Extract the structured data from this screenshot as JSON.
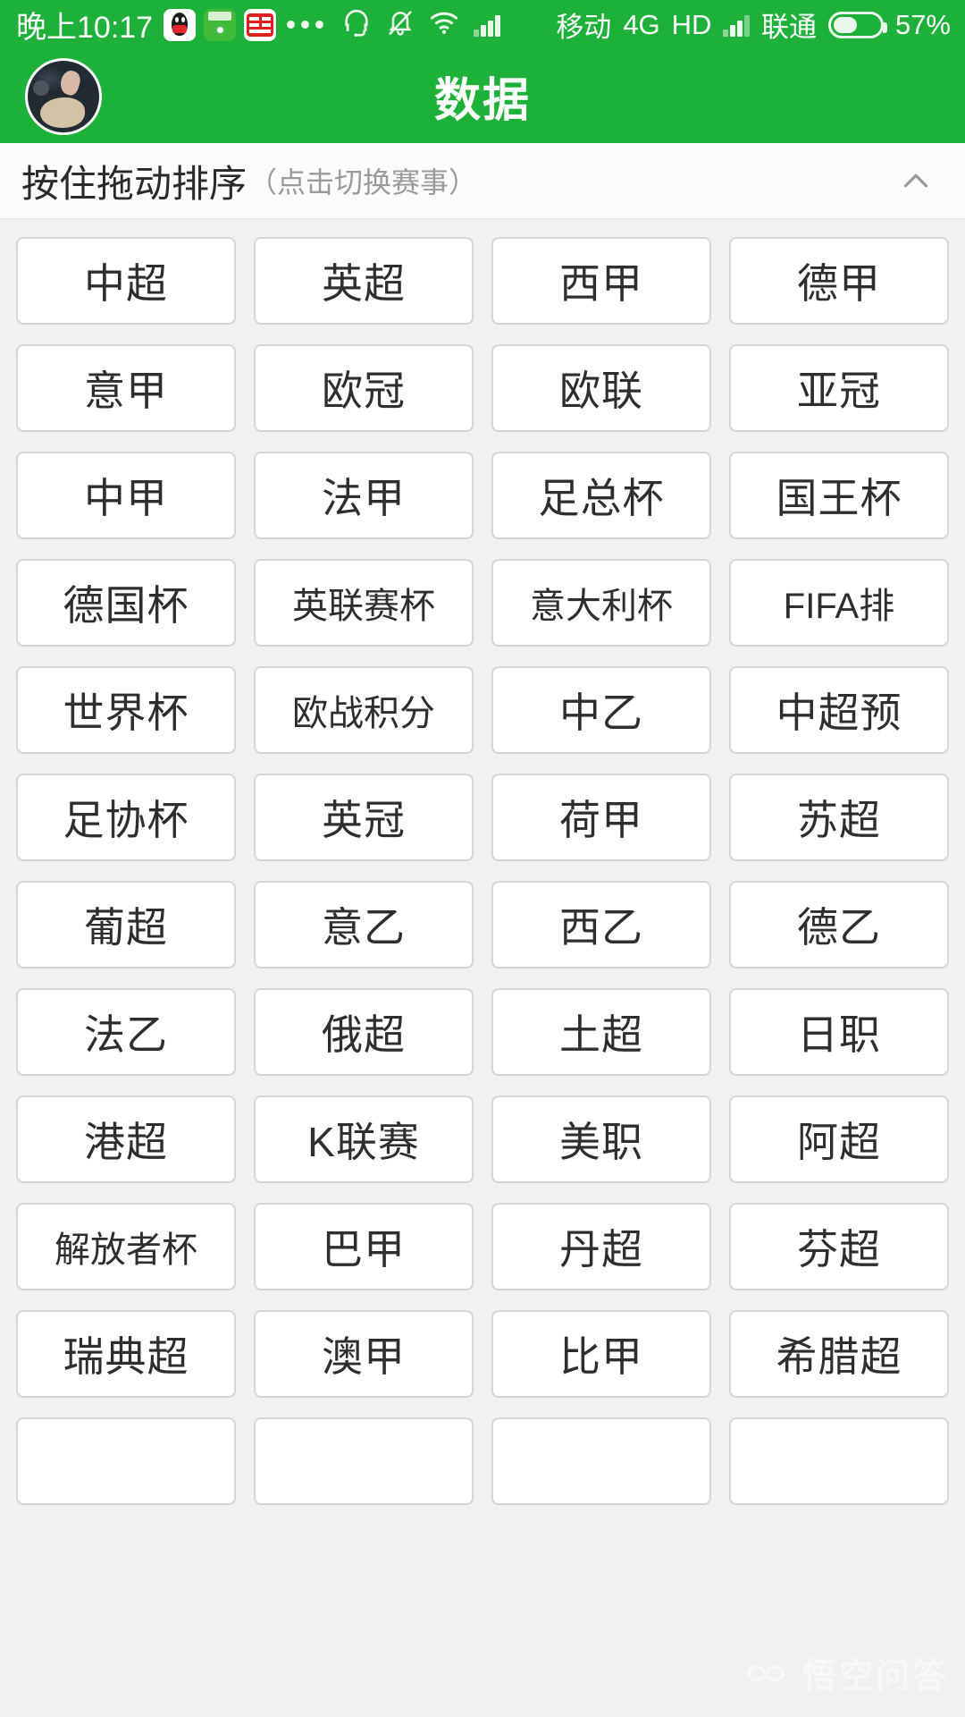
{
  "statusbar": {
    "time": "晚上10:17",
    "app_icons": [
      "qq-icon",
      "football-app-icon",
      "toutiao-icon"
    ],
    "overflow": "more-apps-dots",
    "icons": [
      "headset-icon",
      "bell-muted-icon",
      "wifi-icon",
      "signal-icon"
    ],
    "carrier_primary": "移动",
    "network_type": "4G",
    "hd_label": "HD",
    "carrier_secondary": "联通",
    "battery_percent": "57%",
    "battery_level": 57,
    "background_color": "#1db139",
    "foreground_color": "#ffffff"
  },
  "appbar": {
    "title": "数据",
    "avatar": "user-avatar-photo",
    "background_color": "#1db139"
  },
  "section": {
    "main_label": "按住拖动排序",
    "sub_label": "（点击切换赛事）",
    "collapse_icon": "chevron-up-icon"
  },
  "grid": {
    "columns": 4,
    "items": [
      "中超",
      "英超",
      "西甲",
      "德甲",
      "意甲",
      "欧冠",
      "欧联",
      "亚冠",
      "中甲",
      "法甲",
      "足总杯",
      "国王杯",
      "德国杯",
      "英联赛杯",
      "意大利杯",
      "FIFA排",
      "世界杯",
      "欧战积分",
      "中乙",
      "中超预",
      "足协杯",
      "英冠",
      "荷甲",
      "苏超",
      "葡超",
      "意乙",
      "西乙",
      "德乙",
      "法乙",
      "俄超",
      "土超",
      "日职",
      "港超",
      "K联赛",
      "美职",
      "阿超",
      "解放者杯",
      "巴甲",
      "丹超",
      "芬超",
      "瑞典超",
      "澳甲",
      "比甲",
      "希腊超",
      "",
      "",
      "",
      ""
    ]
  },
  "watermark": {
    "text": "悟空问答",
    "logo": "wukong-logo"
  }
}
